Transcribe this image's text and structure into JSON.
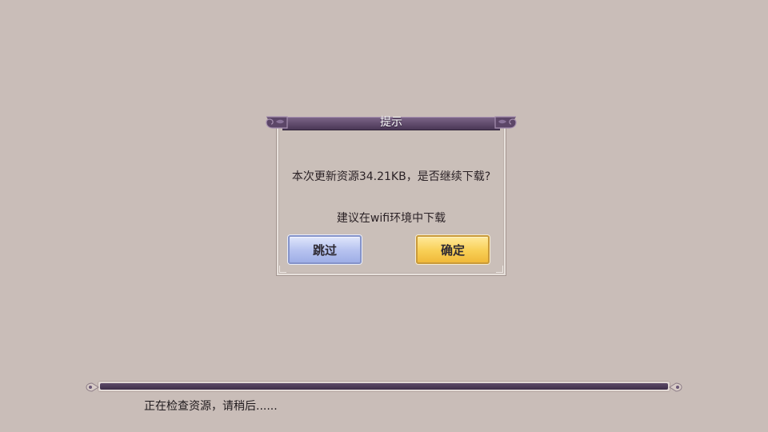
{
  "dialog": {
    "title": "提示",
    "message": "本次更新资源34.21KB，是否继续下载?",
    "subtext": "建议在wifi环境中下载",
    "skip_label": "跳过",
    "confirm_label": "确定"
  },
  "progress": {
    "fraction": 1.0,
    "status_text": "正在检查资源，请稍后......"
  },
  "colors": {
    "background": "#c9bdb8",
    "title_bar": "#5b4567",
    "skip_button": "#b8c4f0",
    "confirm_button": "#f8cf55",
    "progress_fill": "#4a3856"
  }
}
